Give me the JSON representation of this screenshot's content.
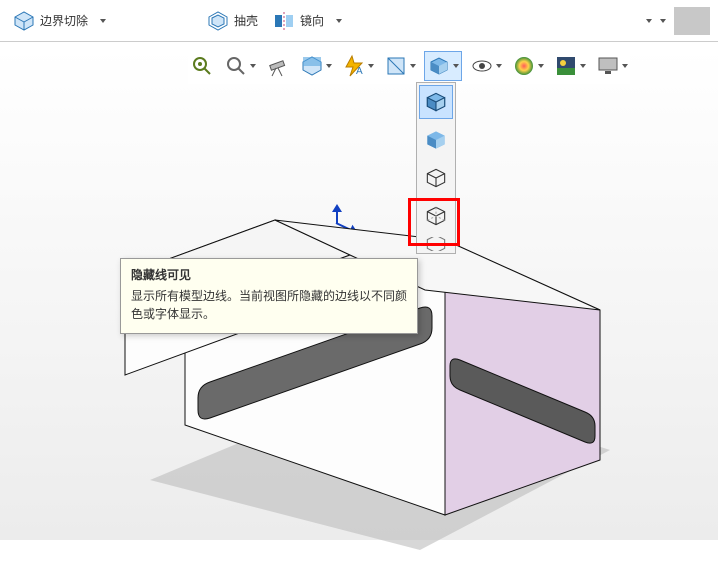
{
  "ribbon": {
    "boundary_cut": "边界切除",
    "shell": "抽壳",
    "mirror": "镜向"
  },
  "viewbar_icons": [
    "zoom-fit-icon",
    "zoom-area-icon",
    "pan-icon",
    "section-icon",
    "draft-analysis-icon",
    "normal-to-icon",
    "display-style-icon",
    "hide-show-icon",
    "appearance-icon",
    "scene-icon",
    "render-icon"
  ],
  "display_style_options": [
    {
      "name": "shaded-with-edges",
      "label": "带边线上色"
    },
    {
      "name": "shaded",
      "label": "上色"
    },
    {
      "name": "hidden-removed",
      "label": "隐藏线隐藏"
    },
    {
      "name": "hidden-visible",
      "label": "隐藏线可见"
    },
    {
      "name": "wireframe",
      "label": "线架图"
    }
  ],
  "tooltip": {
    "title": "隐藏线可见",
    "body": "显示所有模型边线。当前视图所隐藏的边线以不同颜色或字体显示。"
  }
}
